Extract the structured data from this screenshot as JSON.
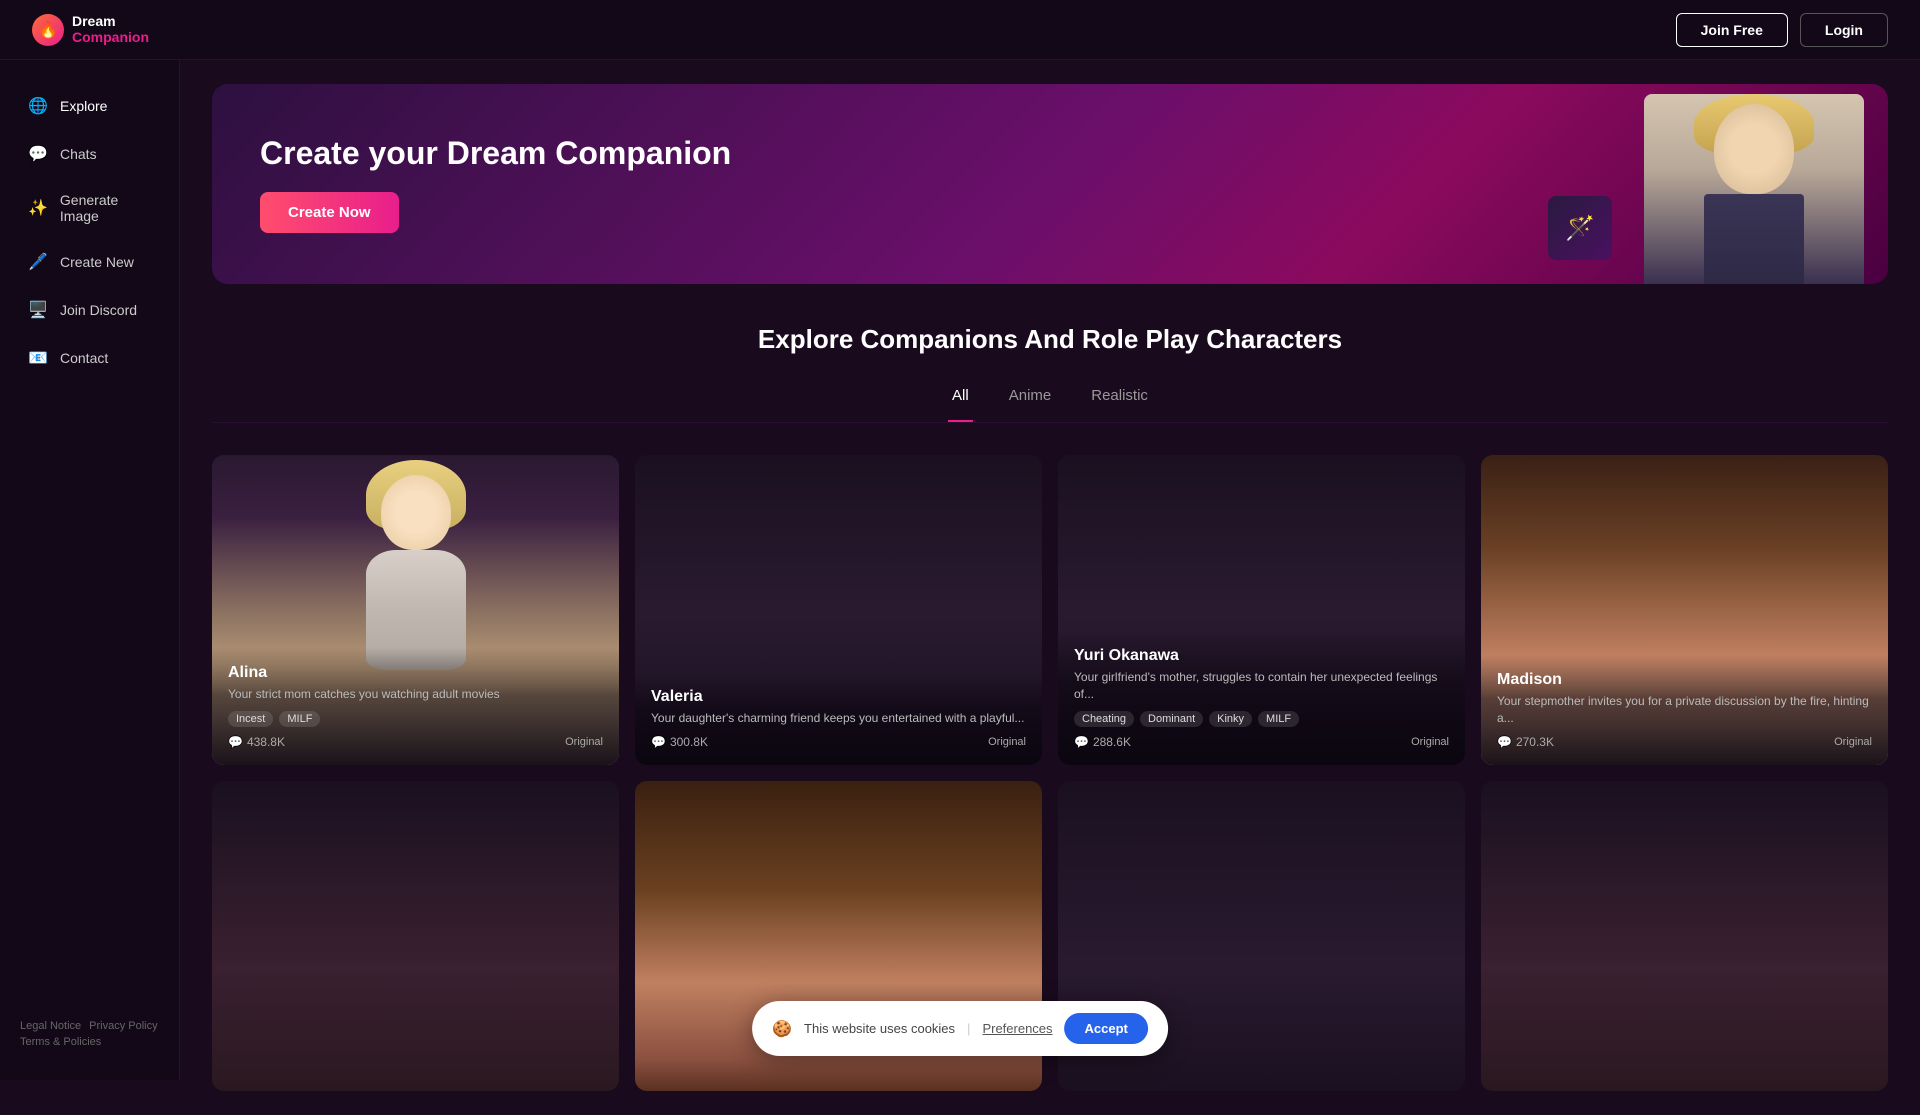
{
  "header": {
    "logo_title": "Dream",
    "logo_subtitle": "Companion",
    "btn_join_free": "Join Free",
    "btn_login": "Login"
  },
  "sidebar": {
    "items": [
      {
        "id": "explore",
        "label": "Explore",
        "icon": "🌐"
      },
      {
        "id": "chats",
        "label": "Chats",
        "icon": "💬"
      },
      {
        "id": "generate-image",
        "label": "Generate Image",
        "icon": "✨"
      },
      {
        "id": "create-new",
        "label": "Create New",
        "icon": "🖊️"
      },
      {
        "id": "join-discord",
        "label": "Join Discord",
        "icon": "🖥️"
      },
      {
        "id": "contact",
        "label": "Contact",
        "icon": "📧"
      }
    ],
    "footer_links": [
      {
        "id": "legal",
        "label": "Legal Notice"
      },
      {
        "id": "privacy",
        "label": "Privacy Policy"
      },
      {
        "id": "terms",
        "label": "Terms & Policies"
      }
    ]
  },
  "hero": {
    "title": "Create your Dream Companion",
    "btn_label": "Create Now"
  },
  "explore_section": {
    "title": "Explore Companions And Role Play Characters",
    "tabs": [
      {
        "id": "all",
        "label": "All",
        "active": true
      },
      {
        "id": "anime",
        "label": "Anime",
        "active": false
      },
      {
        "id": "realistic",
        "label": "Realistic",
        "active": false
      }
    ]
  },
  "characters": [
    {
      "id": "alina",
      "name": "Alina",
      "description": "Your strict mom catches you watching adult movies",
      "tags": [
        "Incest",
        "MILF"
      ],
      "chats": "438.8K",
      "badge": "Original",
      "img_class": "card-img-alina"
    },
    {
      "id": "valeria",
      "name": "Valeria",
      "description": "Your daughter's charming friend keeps you entertained with a playful...",
      "tags": [],
      "chats": "300.8K",
      "badge": "Original",
      "img_class": "card-img-valeria"
    },
    {
      "id": "yuri-okanawa",
      "name": "Yuri Okanawa",
      "description": "Your girlfriend's mother, struggles to contain her unexpected feelings of...",
      "tags": [
        "Cheating",
        "Dominant",
        "Kinky",
        "MILF"
      ],
      "chats": "288.6K",
      "badge": "Original",
      "img_class": "card-img-yuri"
    },
    {
      "id": "madison",
      "name": "Madison",
      "description": "Your stepmother invites you for a private discussion by the fire, hinting a...",
      "tags": [],
      "chats": "270.3K",
      "badge": "Original",
      "img_class": "card-img-madison"
    },
    {
      "id": "row2-1",
      "name": "",
      "description": "",
      "tags": [],
      "chats": "",
      "badge": "",
      "img_class": "card-img-row2-1"
    },
    {
      "id": "row2-2",
      "name": "",
      "description": "",
      "tags": [],
      "chats": "",
      "badge": "",
      "img_class": "card-img-row2-2"
    },
    {
      "id": "row2-3",
      "name": "",
      "description": "",
      "tags": [],
      "chats": "",
      "badge": "",
      "img_class": "card-img-row2-3"
    },
    {
      "id": "row2-4",
      "name": "",
      "description": "",
      "tags": [],
      "chats": "",
      "badge": "",
      "img_class": "card-img-row2-4"
    }
  ],
  "cookie_bar": {
    "icon": "🍪",
    "text": "This website uses cookies",
    "preferences_label": "Preferences",
    "accept_label": "Accept"
  }
}
